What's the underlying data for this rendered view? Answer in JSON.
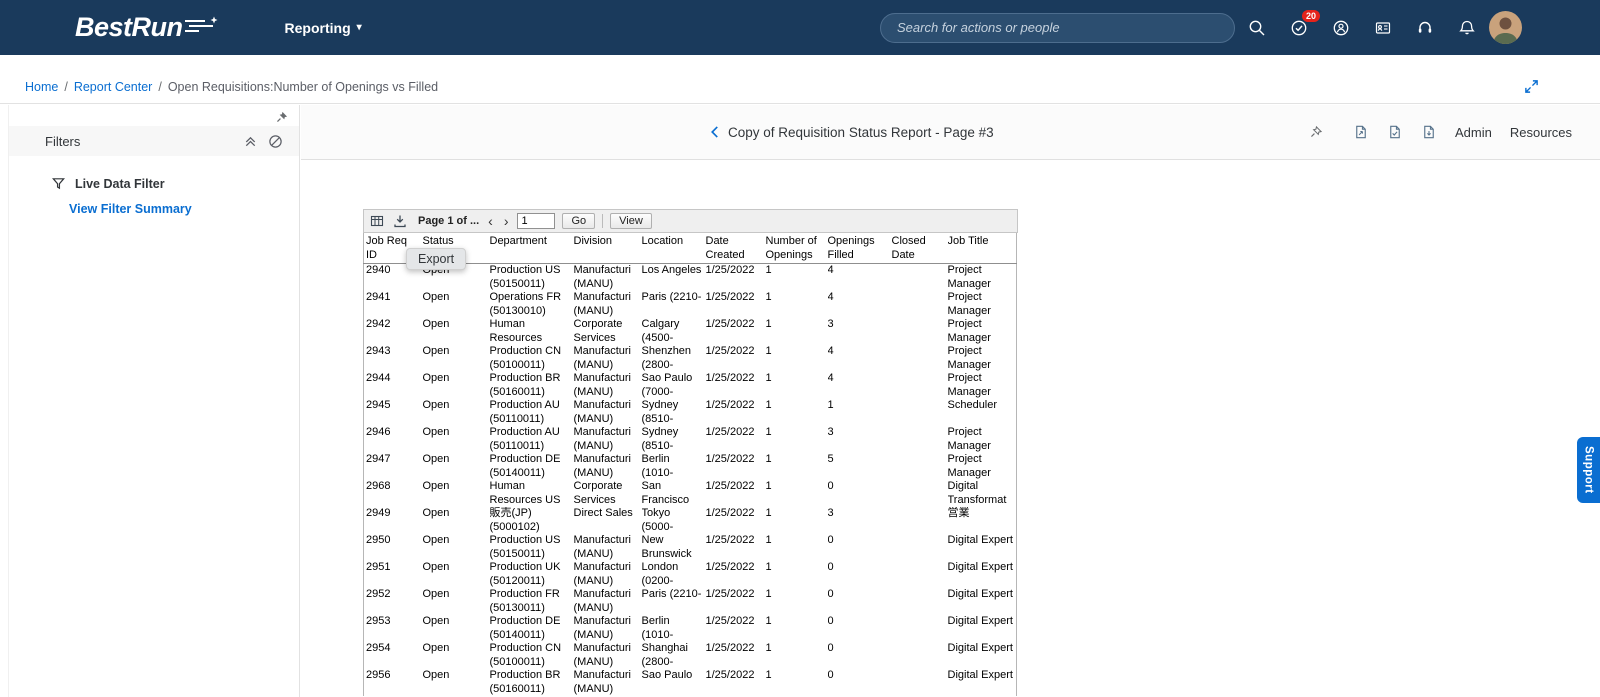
{
  "header": {
    "logo": "BestRun",
    "nav_reporting": "Reporting",
    "search_placeholder": "Search for actions or people",
    "todo_badge": "20"
  },
  "breadcrumb": {
    "items": [
      "Home",
      "Report Center"
    ],
    "separator": "/",
    "current": "Open Requisitions:Number of Openings vs Filled"
  },
  "filters_panel": {
    "title": "Filters",
    "live_data_filter": "Live Data Filter",
    "view_filter_summary": "View Filter Summary"
  },
  "report": {
    "title": "Copy of Requisition Status Report - Page #3",
    "admin_link": "Admin",
    "resources_link": "Resources"
  },
  "toolbar": {
    "page_label": "Page 1 of ...",
    "page_input_value": "1",
    "go_button": "Go",
    "view_button": "View",
    "export_tooltip": "Export"
  },
  "support_tab": {
    "label": "Support"
  },
  "icons": {
    "chevron_down": "▾",
    "chevron_left": "‹",
    "chevron_right": "›"
  },
  "colors": {
    "topbar_navy": "#1a3a5c",
    "link_blue": "#0a6ed1",
    "badge_red": "#e5231b",
    "support_blue": "#0a6ed1"
  },
  "table": {
    "columns": [
      "Job Req ID",
      "Status",
      "Department",
      "Division",
      "Location",
      "Date Created",
      "Number of Openings",
      "Openings Filled",
      "Closed Date",
      "Job Title"
    ],
    "rows": [
      [
        "2940",
        "Open",
        "Production US (50150011)",
        "Manufacturi (MANU)",
        "Los Angeles",
        "1/25/2022",
        "1",
        "4",
        "",
        "Project Manager"
      ],
      [
        "2941",
        "Open",
        "Operations FR (50130010)",
        "Manufacturi (MANU)",
        "Paris (2210-",
        "1/25/2022",
        "1",
        "4",
        "",
        "Project Manager"
      ],
      [
        "2942",
        "Open",
        "Human Resources",
        "Corporate Services",
        "Calgary (4500-",
        "1/25/2022",
        "1",
        "3",
        "",
        "Project Manager"
      ],
      [
        "2943",
        "Open",
        "Production CN (50100011)",
        "Manufacturi (MANU)",
        "Shenzhen (2800-",
        "1/25/2022",
        "1",
        "4",
        "",
        "Project Manager"
      ],
      [
        "2944",
        "Open",
        "Production BR (50160011)",
        "Manufacturi (MANU)",
        "Sao Paulo (7000-",
        "1/25/2022",
        "1",
        "4",
        "",
        "Project Manager"
      ],
      [
        "2945",
        "Open",
        "Production AU (50110011)",
        "Manufacturi (MANU)",
        "Sydney (8510-",
        "1/25/2022",
        "1",
        "1",
        "",
        "Scheduler"
      ],
      [
        "2946",
        "Open",
        "Production AU (50110011)",
        "Manufacturi (MANU)",
        "Sydney (8510-",
        "1/25/2022",
        "1",
        "3",
        "",
        "Project Manager"
      ],
      [
        "2947",
        "Open",
        "Production DE (50140011)",
        "Manufacturi (MANU)",
        "Berlin (1010-",
        "1/25/2022",
        "1",
        "5",
        "",
        "Project Manager"
      ],
      [
        "2968",
        "Open",
        "Human Resources US",
        "Corporate Services",
        "San Francisco",
        "1/25/2022",
        "1",
        "0",
        "",
        "Digital Transformat"
      ],
      [
        "2949",
        "Open",
        "販売(JP) (5000102)",
        "Direct Sales",
        "Tokyo (5000-",
        "1/25/2022",
        "1",
        "3",
        "",
        "営業"
      ],
      [
        "2950",
        "Open",
        "Production US (50150011)",
        "Manufacturi (MANU)",
        "New Brunswick",
        "1/25/2022",
        "1",
        "0",
        "",
        "Digital Expert"
      ],
      [
        "2951",
        "Open",
        "Production UK (50120011)",
        "Manufacturi (MANU)",
        "London (0200-",
        "1/25/2022",
        "1",
        "0",
        "",
        "Digital Expert"
      ],
      [
        "2952",
        "Open",
        "Production FR (50130011)",
        "Manufacturi (MANU)",
        "Paris (2210-",
        "1/25/2022",
        "1",
        "0",
        "",
        "Digital Expert"
      ],
      [
        "2953",
        "Open",
        "Production DE (50140011)",
        "Manufacturi (MANU)",
        "Berlin (1010-",
        "1/25/2022",
        "1",
        "0",
        "",
        "Digital Expert"
      ],
      [
        "2954",
        "Open",
        "Production CN (50100011)",
        "Manufacturi (MANU)",
        "Shanghai (2800-",
        "1/25/2022",
        "1",
        "0",
        "",
        "Digital Expert"
      ],
      [
        "2956",
        "Open",
        "Production BR (50160011)",
        "Manufacturi (MANU)",
        "Sao Paulo",
        "1/25/2022",
        "1",
        "0",
        "",
        "Digital Expert"
      ]
    ]
  }
}
